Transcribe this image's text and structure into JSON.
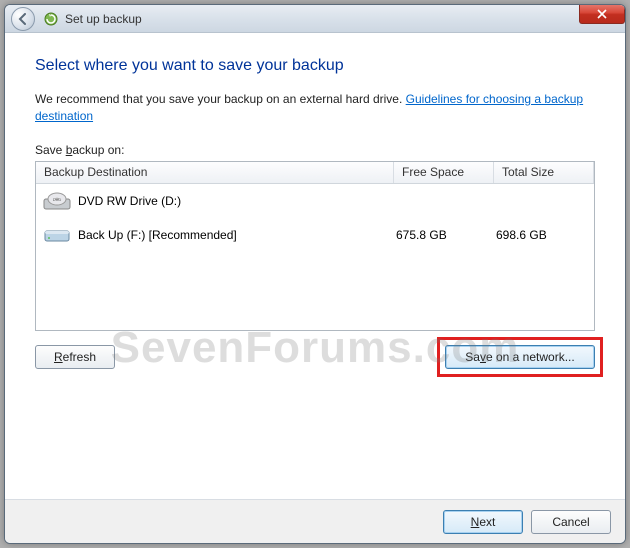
{
  "titlebar": {
    "title": "Set up backup"
  },
  "heading": "Select where you want to save your backup",
  "recommend_text": "We recommend that you save your backup on an external hard drive. ",
  "recommend_link": "Guidelines for choosing a backup destination",
  "save_label": "Save backup on:",
  "columns": {
    "dest": "Backup Destination",
    "free": "Free Space",
    "total": "Total Size"
  },
  "rows": [
    {
      "icon": "dvd",
      "name": "DVD RW Drive (D:)",
      "free": "",
      "total": ""
    },
    {
      "icon": "hdd",
      "name": "Back Up (F:) [Recommended]",
      "free": "675.8 GB",
      "total": "698.6 GB"
    }
  ],
  "buttons": {
    "refresh": "Refresh",
    "save_network": "Save on a network...",
    "next": "Next",
    "cancel": "Cancel"
  },
  "watermark": "SevenForums.com"
}
